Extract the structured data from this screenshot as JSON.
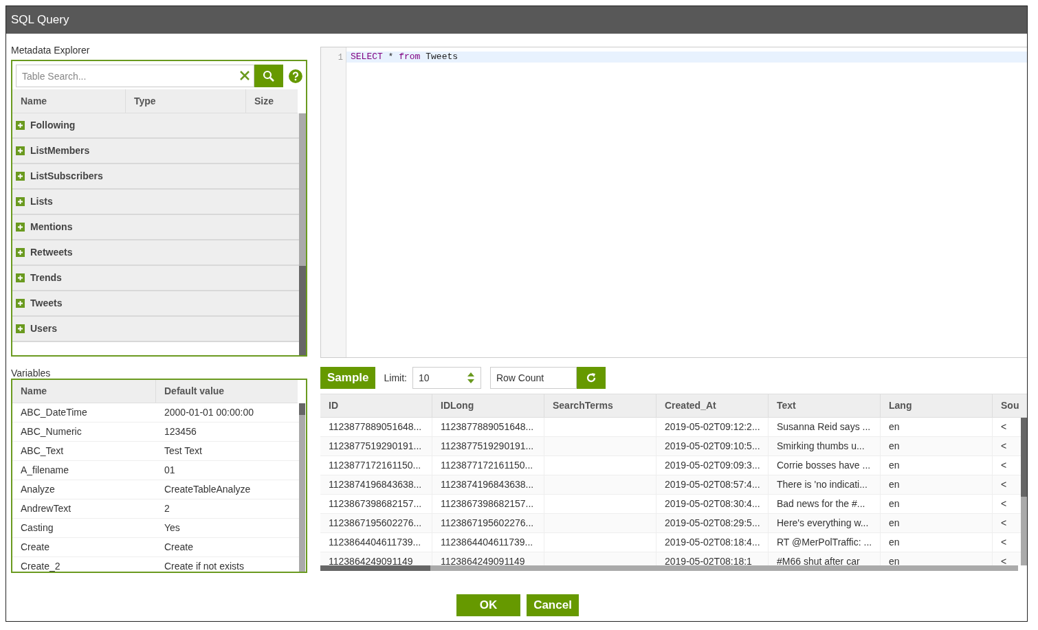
{
  "window": {
    "title": "SQL Query"
  },
  "metadata_explorer": {
    "label": "Metadata Explorer",
    "search": {
      "placeholder": "Table Search..."
    },
    "columns": [
      "Name",
      "Type",
      "Size"
    ],
    "tables": [
      {
        "name": "Following",
        "expanded": false
      },
      {
        "name": "ListMembers",
        "expanded": false
      },
      {
        "name": "ListSubscribers",
        "expanded": false
      },
      {
        "name": "Lists",
        "expanded": false
      },
      {
        "name": "Mentions",
        "expanded": false
      },
      {
        "name": "Retweets",
        "expanded": false
      },
      {
        "name": "Trends",
        "expanded": false
      },
      {
        "name": "Tweets",
        "expanded": false
      },
      {
        "name": "Users",
        "expanded": false
      }
    ]
  },
  "variables": {
    "label": "Variables",
    "columns": [
      "Name",
      "Default value"
    ],
    "rows": [
      [
        "ABC_DateTime",
        "2000-01-01 00:00:00"
      ],
      [
        "ABC_Numeric",
        "123456"
      ],
      [
        "ABC_Text",
        "Test Text"
      ],
      [
        "A_filename",
        "01"
      ],
      [
        "Analyze",
        "CreateTableAnalyze"
      ],
      [
        "AndrewText",
        "2"
      ],
      [
        "Casting",
        "Yes"
      ],
      [
        "Create",
        "Create"
      ],
      [
        "Create_2",
        "Create if not exists"
      ]
    ]
  },
  "editor": {
    "lines": [
      {
        "number": "1",
        "active": true,
        "tokens": [
          {
            "text": "SELECT",
            "kind": "keyword"
          },
          {
            "text": " * ",
            "kind": "plain"
          },
          {
            "text": "from",
            "kind": "keyword"
          },
          {
            "text": " Tweets",
            "kind": "plain"
          }
        ]
      }
    ]
  },
  "toolbar": {
    "sample_button": "Sample",
    "limit_label": "Limit:",
    "limit_value": "10",
    "row_count_placeholder": "Row Count"
  },
  "results": {
    "columns": [
      "ID",
      "IDLong",
      "SearchTerms",
      "Created_At",
      "Text",
      "Lang",
      "Sou"
    ],
    "rows": [
      [
        "1123877889051648...",
        "1123877889051648...",
        "",
        "2019-05-02T09:12:2...",
        "Susanna Reid says ...",
        "en",
        "<"
      ],
      [
        "1123877519290191...",
        "1123877519290191...",
        "",
        "2019-05-02T09:10:5...",
        "Smirking thumbs u...",
        "en",
        "<"
      ],
      [
        "1123877172161150...",
        "1123877172161150...",
        "",
        "2019-05-02T09:09:3...",
        "Corrie bosses have ...",
        "en",
        "<"
      ],
      [
        "1123874196843638...",
        "1123874196843638...",
        "",
        "2019-05-02T08:57:4...",
        "There is 'no indicati...",
        "en",
        "<"
      ],
      [
        "1123867398682157...",
        "1123867398682157...",
        "",
        "2019-05-02T08:30:4...",
        "Bad news for the #...",
        "en",
        "<"
      ],
      [
        "1123867195602276...",
        "1123867195602276...",
        "",
        "2019-05-02T08:29:5...",
        "Here's everything w...",
        "en",
        "<"
      ],
      [
        "1123864404611739...",
        "1123864404611739...",
        "",
        "2019-05-02T08:18:4...",
        "RT @MerPolTraffic: ...",
        "en",
        "<"
      ],
      [
        "1123864249091149",
        "1123864249091149",
        "",
        "2019-05-02T08:18:1",
        "#M66 shut after car",
        "en",
        "<"
      ]
    ]
  },
  "buttons": [
    "OK",
    "Cancel"
  ]
}
